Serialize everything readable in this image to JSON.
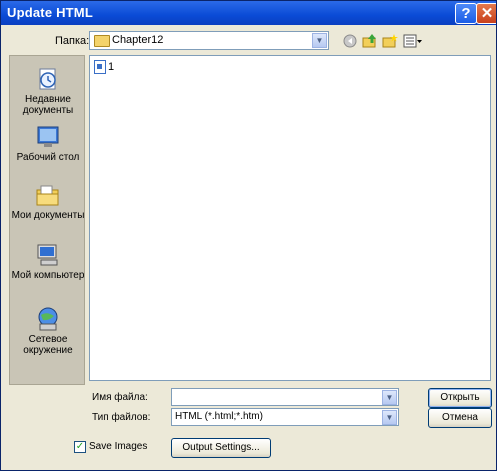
{
  "window": {
    "title": "Update HTML",
    "help_glyph": "?",
    "close_glyph": "✕"
  },
  "toolbar": {
    "look_in_label": "Папка:",
    "look_in_value": "Chapter12",
    "icons": [
      "back-icon",
      "up-folder-icon",
      "new-folder-icon",
      "views-menu-icon"
    ]
  },
  "places": [
    {
      "label": "Недавние документы",
      "icon": "recent-documents-icon"
    },
    {
      "label": "Рабочий стол",
      "icon": "desktop-icon"
    },
    {
      "label": "Мои документы",
      "icon": "my-documents-icon"
    },
    {
      "label": "Мой компьютер",
      "icon": "my-computer-icon"
    },
    {
      "label": "Сетевое окружение",
      "icon": "network-icon"
    }
  ],
  "files": [
    {
      "name": "1"
    }
  ],
  "form": {
    "filename_label": "Имя файла:",
    "filename_value": "",
    "filetype_label": "Тип файлов:",
    "filetype_value": "HTML (*.html;*.htm)",
    "open_label": "Открыть",
    "cancel_label": "Отмена"
  },
  "options": {
    "save_images_label": "Save Images",
    "save_images_checked": true,
    "output_settings_label": "Output Settings..."
  },
  "colors": {
    "titlebar": "#0a4bd6",
    "dialog_bg": "#ece9d8",
    "places_bg": "#c9c5b6"
  }
}
